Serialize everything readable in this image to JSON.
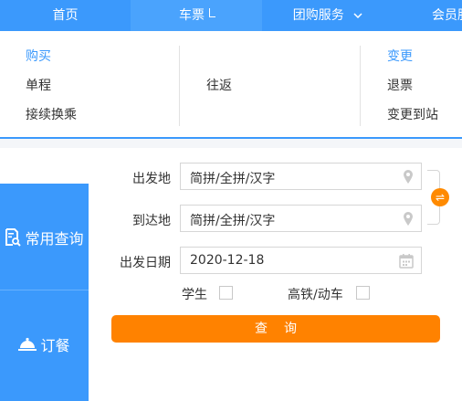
{
  "nav": {
    "items": [
      {
        "label": "首页"
      },
      {
        "label": "车票"
      },
      {
        "label": "团购服务"
      },
      {
        "label": "会员服"
      }
    ]
  },
  "dropdown": {
    "col1": {
      "header": "购买",
      "items": [
        "单程",
        "接续换乘"
      ]
    },
    "col2": {
      "items": [
        "往返"
      ]
    },
    "col3": {
      "header": "变更",
      "items": [
        "退票",
        "变更到站"
      ]
    }
  },
  "sidemenu": {
    "items": [
      {
        "label": "常用查询",
        "icon": "search-document-icon"
      },
      {
        "label": "订餐",
        "icon": "meal-cloche-icon"
      }
    ]
  },
  "form": {
    "from_label": "出发地",
    "from_value": "简拼/全拼/汉字",
    "to_label": "到达地",
    "to_value": "简拼/全拼/汉字",
    "date_label": "出发日期",
    "date_value": "2020-12-18",
    "student_label": "学生",
    "highspeed_label": "高铁/动车",
    "query_label": "查询",
    "swap_glyph": "⇌"
  },
  "colors": {
    "primary": "#3b99fc",
    "accent": "#ff8200"
  }
}
